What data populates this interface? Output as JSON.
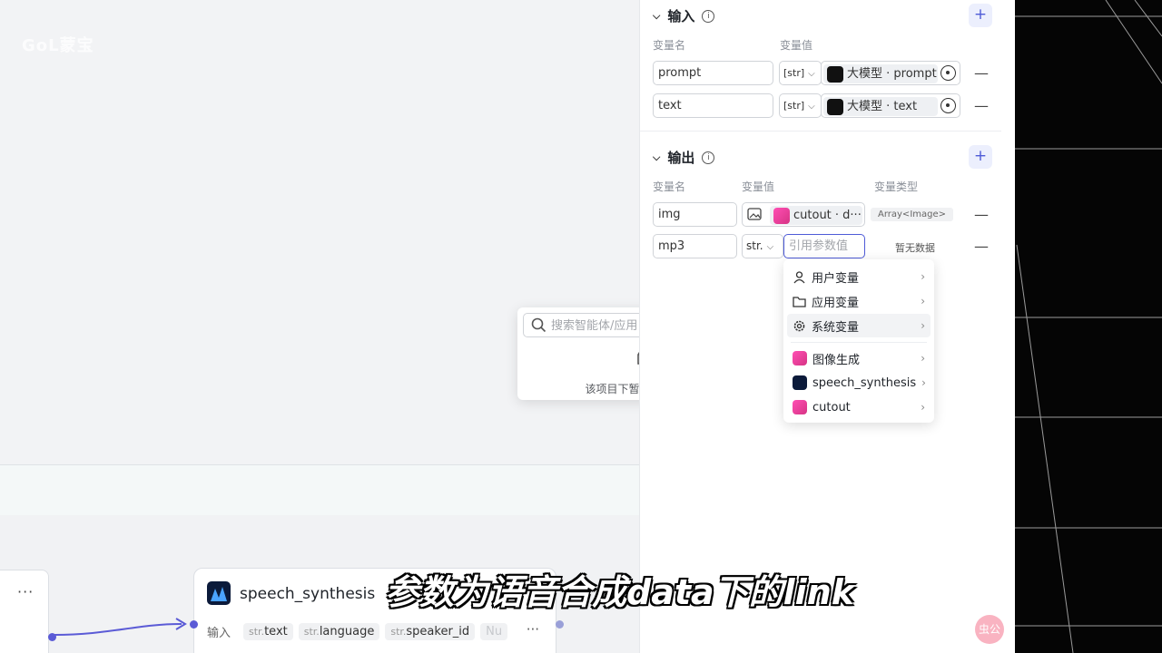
{
  "canvas": {
    "watermark": "GoL蒙宝",
    "speech_node": {
      "title": "speech_synthesis",
      "input_label": "输入",
      "params": [
        {
          "type": "str.",
          "name": "text"
        },
        {
          "type": "str.",
          "name": "language"
        },
        {
          "type": "str.",
          "name": "speaker_id"
        }
      ],
      "faded_param": "Nu"
    }
  },
  "search_popover": {
    "placeholder": "搜索智能体/应用",
    "empty_text": "该项目下暂时没有定义变量"
  },
  "panel": {
    "input_section": {
      "title": "输入",
      "col_name": "变量名",
      "col_value": "变量值",
      "rows": [
        {
          "name": "prompt",
          "type": "[str]",
          "source": "大模型 · prompt"
        },
        {
          "name": "text",
          "type": "[str]",
          "source": "大模型 · text"
        }
      ]
    },
    "output_section": {
      "title": "输出",
      "col_name": "变量名",
      "col_value": "变量值",
      "col_type": "变量类型",
      "rows": [
        {
          "name": "img",
          "source": "cutout · d···",
          "var_type": "Array<Image>"
        },
        {
          "name": "mp3",
          "type": "str.",
          "value_placeholder": "引用参数值",
          "var_type": "暂无数据"
        }
      ]
    }
  },
  "var_menu": {
    "items": [
      {
        "label": "用户变量",
        "icon": "user-icon"
      },
      {
        "label": "应用变量",
        "icon": "folder-icon"
      },
      {
        "label": "系统变量",
        "icon": "gear-icon"
      },
      {
        "label": "图像生成",
        "icon": "image-gen-icon"
      },
      {
        "label": "speech_synthesis",
        "icon": "speech-synthesis-icon"
      },
      {
        "label": "cutout",
        "icon": "cutout-icon"
      }
    ]
  },
  "subtitle": "参数为语音合成data下的link",
  "corner_logo": "虫公"
}
